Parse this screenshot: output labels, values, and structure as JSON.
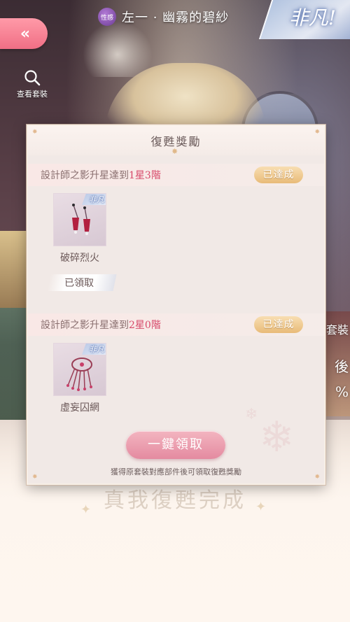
{
  "header": {
    "trait_badge": "性感",
    "title": "左一 · 幽霧的碧紗",
    "rarity": "非凡!",
    "back_icon": "double-chevron-left-icon"
  },
  "sidebar": {
    "view_outfit_label": "查看套裝",
    "view_outfit_icon": "magnifier-icon"
  },
  "background": {
    "watermark": "真我復甦完成",
    "right_partial_texts": [
      "套裝",
      "後",
      "%"
    ]
  },
  "modal": {
    "title": "復甦獎勵",
    "sections": [
      {
        "requirement_prefix": "設計師之影升星達到",
        "requirement_value": "1星3階",
        "status": "已達成",
        "reward": {
          "name": "破碎烈火",
          "rarity": "非凡",
          "icon": "earrings-icon",
          "claimed_label": "已領取"
        }
      },
      {
        "requirement_prefix": "設計師之影升星達到",
        "requirement_value": "2星0階",
        "status": "已達成",
        "reward": {
          "name": "虛妄囚網",
          "rarity": "非凡",
          "icon": "hand-accessory-icon"
        }
      }
    ],
    "claim_all_label": "一鍵領取",
    "hint": "獲得原套裝對應部件後可領取復甦獎勵"
  },
  "colors": {
    "accent_pink": "#e48aa0",
    "highlight_red": "#d7496a",
    "achieved_gold": "#e8bb78",
    "back_button": "#f06f85"
  }
}
